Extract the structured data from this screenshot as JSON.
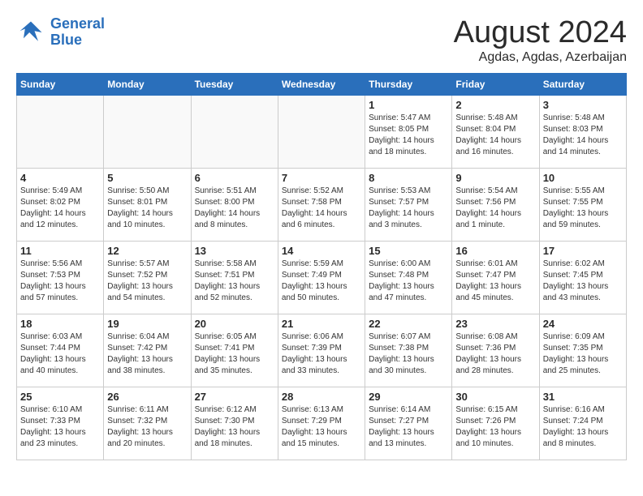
{
  "header": {
    "logo_line1": "General",
    "logo_line2": "Blue",
    "main_title": "August 2024",
    "subtitle": "Agdas, Agdas, Azerbaijan"
  },
  "calendar": {
    "days_of_week": [
      "Sunday",
      "Monday",
      "Tuesday",
      "Wednesday",
      "Thursday",
      "Friday",
      "Saturday"
    ],
    "weeks": [
      [
        {
          "day": "",
          "info": ""
        },
        {
          "day": "",
          "info": ""
        },
        {
          "day": "",
          "info": ""
        },
        {
          "day": "",
          "info": ""
        },
        {
          "day": "1",
          "info": "Sunrise: 5:47 AM\nSunset: 8:05 PM\nDaylight: 14 hours\nand 18 minutes."
        },
        {
          "day": "2",
          "info": "Sunrise: 5:48 AM\nSunset: 8:04 PM\nDaylight: 14 hours\nand 16 minutes."
        },
        {
          "day": "3",
          "info": "Sunrise: 5:48 AM\nSunset: 8:03 PM\nDaylight: 14 hours\nand 14 minutes."
        }
      ],
      [
        {
          "day": "4",
          "info": "Sunrise: 5:49 AM\nSunset: 8:02 PM\nDaylight: 14 hours\nand 12 minutes."
        },
        {
          "day": "5",
          "info": "Sunrise: 5:50 AM\nSunset: 8:01 PM\nDaylight: 14 hours\nand 10 minutes."
        },
        {
          "day": "6",
          "info": "Sunrise: 5:51 AM\nSunset: 8:00 PM\nDaylight: 14 hours\nand 8 minutes."
        },
        {
          "day": "7",
          "info": "Sunrise: 5:52 AM\nSunset: 7:58 PM\nDaylight: 14 hours\nand 6 minutes."
        },
        {
          "day": "8",
          "info": "Sunrise: 5:53 AM\nSunset: 7:57 PM\nDaylight: 14 hours\nand 3 minutes."
        },
        {
          "day": "9",
          "info": "Sunrise: 5:54 AM\nSunset: 7:56 PM\nDaylight: 14 hours\nand 1 minute."
        },
        {
          "day": "10",
          "info": "Sunrise: 5:55 AM\nSunset: 7:55 PM\nDaylight: 13 hours\nand 59 minutes."
        }
      ],
      [
        {
          "day": "11",
          "info": "Sunrise: 5:56 AM\nSunset: 7:53 PM\nDaylight: 13 hours\nand 57 minutes."
        },
        {
          "day": "12",
          "info": "Sunrise: 5:57 AM\nSunset: 7:52 PM\nDaylight: 13 hours\nand 54 minutes."
        },
        {
          "day": "13",
          "info": "Sunrise: 5:58 AM\nSunset: 7:51 PM\nDaylight: 13 hours\nand 52 minutes."
        },
        {
          "day": "14",
          "info": "Sunrise: 5:59 AM\nSunset: 7:49 PM\nDaylight: 13 hours\nand 50 minutes."
        },
        {
          "day": "15",
          "info": "Sunrise: 6:00 AM\nSunset: 7:48 PM\nDaylight: 13 hours\nand 47 minutes."
        },
        {
          "day": "16",
          "info": "Sunrise: 6:01 AM\nSunset: 7:47 PM\nDaylight: 13 hours\nand 45 minutes."
        },
        {
          "day": "17",
          "info": "Sunrise: 6:02 AM\nSunset: 7:45 PM\nDaylight: 13 hours\nand 43 minutes."
        }
      ],
      [
        {
          "day": "18",
          "info": "Sunrise: 6:03 AM\nSunset: 7:44 PM\nDaylight: 13 hours\nand 40 minutes."
        },
        {
          "day": "19",
          "info": "Sunrise: 6:04 AM\nSunset: 7:42 PM\nDaylight: 13 hours\nand 38 minutes."
        },
        {
          "day": "20",
          "info": "Sunrise: 6:05 AM\nSunset: 7:41 PM\nDaylight: 13 hours\nand 35 minutes."
        },
        {
          "day": "21",
          "info": "Sunrise: 6:06 AM\nSunset: 7:39 PM\nDaylight: 13 hours\nand 33 minutes."
        },
        {
          "day": "22",
          "info": "Sunrise: 6:07 AM\nSunset: 7:38 PM\nDaylight: 13 hours\nand 30 minutes."
        },
        {
          "day": "23",
          "info": "Sunrise: 6:08 AM\nSunset: 7:36 PM\nDaylight: 13 hours\nand 28 minutes."
        },
        {
          "day": "24",
          "info": "Sunrise: 6:09 AM\nSunset: 7:35 PM\nDaylight: 13 hours\nand 25 minutes."
        }
      ],
      [
        {
          "day": "25",
          "info": "Sunrise: 6:10 AM\nSunset: 7:33 PM\nDaylight: 13 hours\nand 23 minutes."
        },
        {
          "day": "26",
          "info": "Sunrise: 6:11 AM\nSunset: 7:32 PM\nDaylight: 13 hours\nand 20 minutes."
        },
        {
          "day": "27",
          "info": "Sunrise: 6:12 AM\nSunset: 7:30 PM\nDaylight: 13 hours\nand 18 minutes."
        },
        {
          "day": "28",
          "info": "Sunrise: 6:13 AM\nSunset: 7:29 PM\nDaylight: 13 hours\nand 15 minutes."
        },
        {
          "day": "29",
          "info": "Sunrise: 6:14 AM\nSunset: 7:27 PM\nDaylight: 13 hours\nand 13 minutes."
        },
        {
          "day": "30",
          "info": "Sunrise: 6:15 AM\nSunset: 7:26 PM\nDaylight: 13 hours\nand 10 minutes."
        },
        {
          "day": "31",
          "info": "Sunrise: 6:16 AM\nSunset: 7:24 PM\nDaylight: 13 hours\nand 8 minutes."
        }
      ]
    ]
  }
}
